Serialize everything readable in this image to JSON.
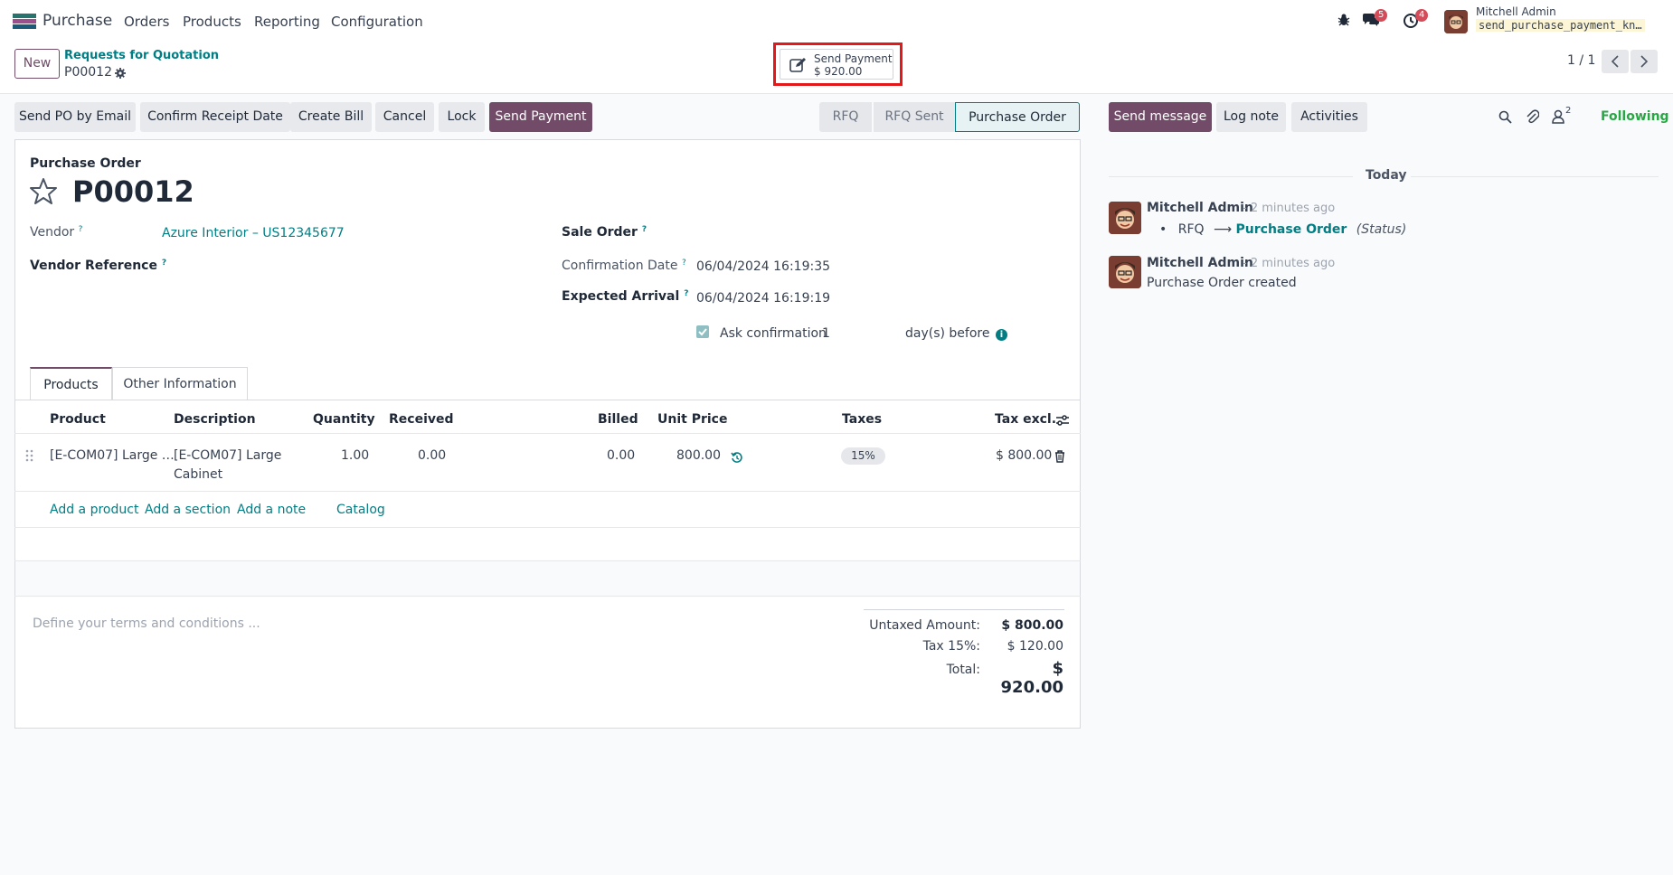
{
  "navbar": {
    "app_name": "Purchase",
    "menu": [
      "Orders",
      "Products",
      "Reporting",
      "Configuration"
    ],
    "messages_count": "5",
    "activities_count": "4",
    "user_name": "Mitchell Admin",
    "db_name": "send_purchase_payment_kn…"
  },
  "control_panel": {
    "new_label": "New",
    "breadcrumb_parent": "Requests for Quotation",
    "breadcrumb_current": "P00012",
    "smart_button_label": "Send Payment",
    "smart_button_value": "$ 920.00",
    "pager": "1 / 1"
  },
  "actions": {
    "send_po_email": "Send PO by Email",
    "confirm_receipt": "Confirm Receipt Date",
    "create_bill": "Create Bill",
    "cancel": "Cancel",
    "lock": "Lock",
    "send_payment": "Send Payment"
  },
  "statusbar": [
    "RFQ",
    "RFQ Sent",
    "Purchase Order"
  ],
  "form": {
    "type_label": "Purchase Order",
    "name": "P00012",
    "vendor_label": "Vendor",
    "vendor_value": "Azure Interior – US12345677",
    "vendor_ref_label": "Vendor Reference",
    "sale_order_label": "Sale Order",
    "confirmation_date_label": "Confirmation Date",
    "confirmation_date_value": "06/04/2024 16:19:35",
    "expected_arrival_label": "Expected Arrival",
    "expected_arrival_value": "06/04/2024 16:19:19",
    "ask_confirmation_label": "Ask confirmation",
    "ask_confirmation_days": "1",
    "days_before_label": "day(s) before"
  },
  "tabs": [
    "Products",
    "Other Information"
  ],
  "table": {
    "headers": {
      "product": "Product",
      "description": "Description",
      "quantity": "Quantity",
      "received": "Received",
      "billed": "Billed",
      "unit_price": "Unit Price",
      "taxes": "Taxes",
      "tax_excl": "Tax excl."
    },
    "rows": [
      {
        "product": "[E-COM07] Large …",
        "description_1": "[E-COM07] Large",
        "description_2": "Cabinet",
        "quantity": "1.00",
        "received": "0.00",
        "billed": "0.00",
        "unit_price": "800.00",
        "tax": "15%",
        "subtotal": "$ 800.00"
      }
    ],
    "add_product": "Add a product",
    "add_section": "Add a section",
    "add_note": "Add a note",
    "catalog": "Catalog"
  },
  "terms_placeholder": "Define your terms and conditions ...",
  "totals": {
    "untaxed_label": "Untaxed Amount:",
    "untaxed_value": "$ 800.00",
    "tax_label": "Tax 15%:",
    "tax_value": "$ 120.00",
    "total_label": "Total:",
    "total_value": "$ 920.00"
  },
  "chatter": {
    "send_message": "Send message",
    "log_note": "Log note",
    "activities": "Activities",
    "followers_count": "2",
    "following": "Following",
    "today": "Today",
    "messages": [
      {
        "author": "Mitchell Admin",
        "ago": "- 2 minutes ago",
        "from_status": "RFQ",
        "to_status": "Purchase Order",
        "field": "(Status)"
      },
      {
        "author": "Mitchell Admin",
        "ago": "- 2 minutes ago",
        "body": "Purchase Order created"
      }
    ]
  },
  "colors": {
    "brand": "#714b67",
    "link": "#017e84",
    "highlight": "#e3181b",
    "following": "#28a745"
  }
}
